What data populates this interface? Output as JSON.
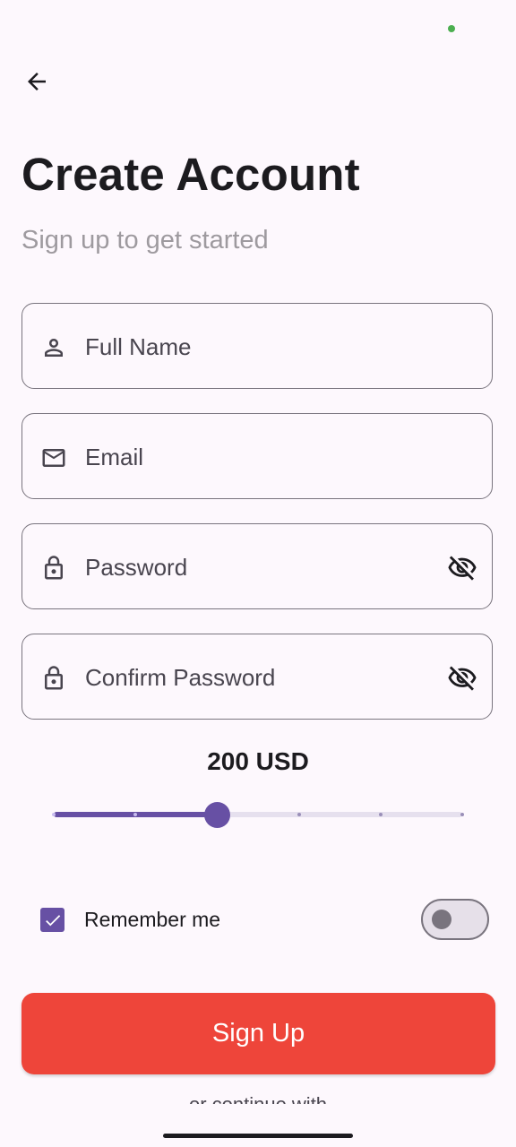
{
  "header": {
    "title": "Create Account",
    "subtitle": "Sign up to get started"
  },
  "form": {
    "fields": [
      {
        "id": "full-name",
        "placeholder": "Full Name",
        "icon": "person-icon",
        "value": ""
      },
      {
        "id": "email",
        "placeholder": "Email",
        "icon": "mail-icon",
        "value": ""
      },
      {
        "id": "password",
        "placeholder": "Password",
        "icon": "lock-icon",
        "trailing_icon": "visibility-off-icon",
        "value": ""
      },
      {
        "id": "confirm-password",
        "placeholder": "Confirm Password",
        "icon": "lock-icon",
        "trailing_icon": "visibility-off-icon",
        "value": ""
      }
    ]
  },
  "amount": {
    "label": "200 USD",
    "value": 200,
    "min": 0,
    "max": 500,
    "divisions": 5
  },
  "remember": {
    "label": "Remember me",
    "checked": true
  },
  "toggle": {
    "on": false
  },
  "signup": {
    "label": "Sign Up"
  },
  "footer": {
    "partial_text": "or continue with"
  },
  "colors": {
    "accent": "#6750a4",
    "button": "#ee453a",
    "background": "#fdf8fd",
    "outline": "#79747e",
    "subtitle": "#9e9a9f"
  }
}
